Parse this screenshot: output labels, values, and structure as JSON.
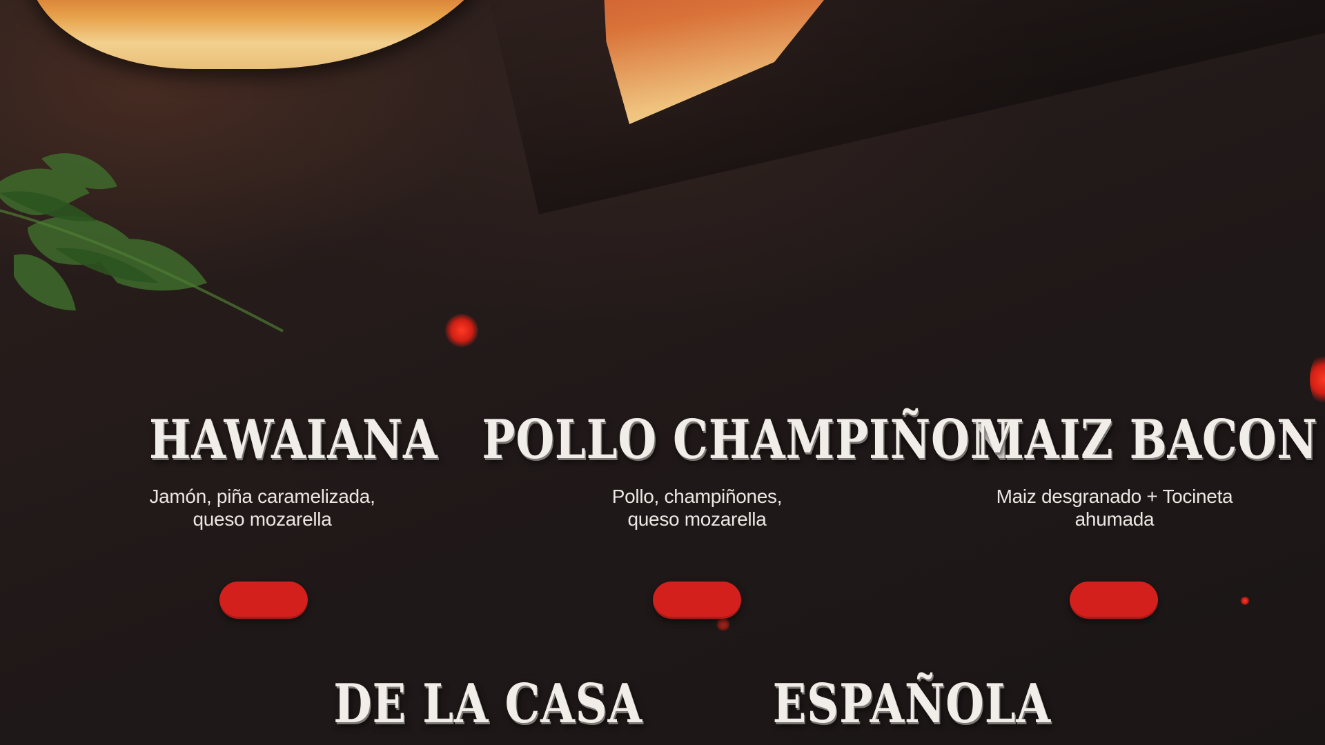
{
  "menu": {
    "items": [
      {
        "title": "HAWAIANA",
        "desc_line1": "Jamón, piña caramelizada,",
        "desc_line2": "queso mozarella"
      },
      {
        "title": "POLLO CHAMPIÑON",
        "desc_line1": "Pollo, champiñones,",
        "desc_line2": "queso mozarella"
      },
      {
        "title": "MAIZ BACON",
        "desc_line1": "Maiz desgranado + Tocineta",
        "desc_line2": "ahumada"
      },
      {
        "title": "DE LA CASA"
      },
      {
        "title": "ESPAÑOLA"
      }
    ]
  },
  "colors": {
    "background": "#1e1717",
    "title_text": "#f1ede8",
    "body_text": "#ece7e3",
    "accent_red": "#d3201d"
  },
  "icons": [
    "pizza-slice-image",
    "cilantro-leaf-image",
    "ember-dot"
  ]
}
